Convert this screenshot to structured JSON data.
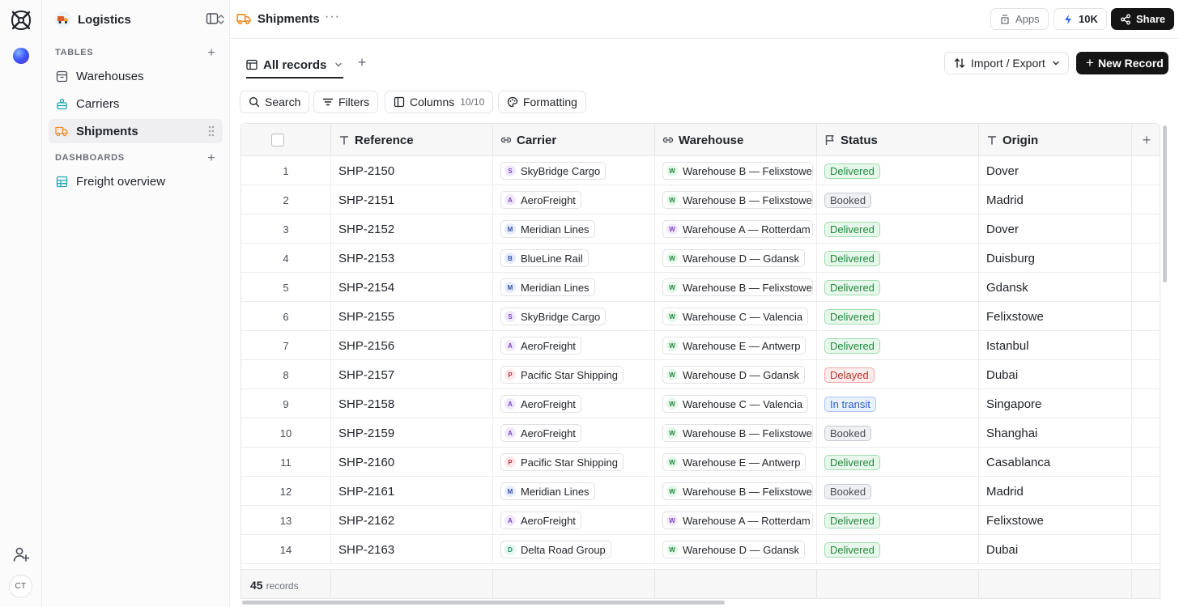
{
  "rail": {
    "avatar_initials": "CT"
  },
  "sidebar": {
    "workspace": "Logistics",
    "tables_heading": "TABLES",
    "tables": [
      {
        "label": "Warehouses",
        "icon": "warehouse-icon",
        "color": "#4a4e55",
        "active": false
      },
      {
        "label": "Carriers",
        "icon": "carriers-icon",
        "color": "#1ba7b0",
        "active": false
      },
      {
        "label": "Shipments",
        "icon": "truck-icon",
        "color": "#f08a24",
        "active": true
      }
    ],
    "dashboards_heading": "DASHBOARDS",
    "dashboards": [
      {
        "label": "Freight overview",
        "icon": "dashboard-icon",
        "color": "#1ba7b0"
      }
    ]
  },
  "topbar": {
    "title": "Shipments",
    "apps_label": "Apps",
    "credits_label": "10K",
    "share_label": "Share"
  },
  "view": {
    "tab_label": "All records",
    "import_label": "Import / Export",
    "new_record_label": "New Record"
  },
  "toolbar": {
    "search_label": "Search",
    "filters_label": "Filters",
    "columns_label": "Columns",
    "columns_count": "10/10",
    "formatting_label": "Formatting"
  },
  "table": {
    "columns": [
      {
        "label": "Reference",
        "icon": "text-type-icon"
      },
      {
        "label": "Carrier",
        "icon": "link-icon"
      },
      {
        "label": "Warehouse",
        "icon": "link-icon"
      },
      {
        "label": "Status",
        "icon": "flag-icon"
      },
      {
        "label": "Origin",
        "icon": "text-type-icon"
      }
    ],
    "rows": [
      {
        "num": "1",
        "ref": "SHP-2150",
        "carrier": "SkyBridge Cargo",
        "carrier_initial": "S",
        "warehouse": "Warehouse B — Felixstowe",
        "wh_initial": "W",
        "status": "Delivered",
        "origin": "Dover"
      },
      {
        "num": "2",
        "ref": "SHP-2151",
        "carrier": "AeroFreight",
        "carrier_initial": "A",
        "warehouse": "Warehouse B — Felixstowe",
        "wh_initial": "W",
        "status": "Booked",
        "origin": "Madrid"
      },
      {
        "num": "3",
        "ref": "SHP-2152",
        "carrier": "Meridian Lines",
        "carrier_initial": "M",
        "warehouse": "Warehouse A — Rotterdam",
        "wh_initial": "W",
        "status": "Delivered",
        "origin": "Dover"
      },
      {
        "num": "4",
        "ref": "SHP-2153",
        "carrier": "BlueLine Rail",
        "carrier_initial": "B",
        "warehouse": "Warehouse D — Gdansk",
        "wh_initial": "W",
        "status": "Delivered",
        "origin": "Duisburg"
      },
      {
        "num": "5",
        "ref": "SHP-2154",
        "carrier": "Meridian Lines",
        "carrier_initial": "M",
        "warehouse": "Warehouse B — Felixstowe",
        "wh_initial": "W",
        "status": "Delivered",
        "origin": "Gdansk"
      },
      {
        "num": "6",
        "ref": "SHP-2155",
        "carrier": "SkyBridge Cargo",
        "carrier_initial": "S",
        "warehouse": "Warehouse C — Valencia",
        "wh_initial": "W",
        "status": "Delivered",
        "origin": "Felixstowe"
      },
      {
        "num": "7",
        "ref": "SHP-2156",
        "carrier": "AeroFreight",
        "carrier_initial": "A",
        "warehouse": "Warehouse E — Antwerp",
        "wh_initial": "W",
        "status": "Delivered",
        "origin": "Istanbul"
      },
      {
        "num": "8",
        "ref": "SHP-2157",
        "carrier": "Pacific Star Shipping",
        "carrier_initial": "P",
        "warehouse": "Warehouse D — Gdansk",
        "wh_initial": "W",
        "status": "Delayed",
        "origin": "Dubai"
      },
      {
        "num": "9",
        "ref": "SHP-2158",
        "carrier": "AeroFreight",
        "carrier_initial": "A",
        "warehouse": "Warehouse C — Valencia",
        "wh_initial": "W",
        "status": "In transit",
        "origin": "Singapore"
      },
      {
        "num": "10",
        "ref": "SHP-2159",
        "carrier": "AeroFreight",
        "carrier_initial": "A",
        "warehouse": "Warehouse B — Felixstowe",
        "wh_initial": "W",
        "status": "Booked",
        "origin": "Shanghai"
      },
      {
        "num": "11",
        "ref": "SHP-2160",
        "carrier": "Pacific Star Shipping",
        "carrier_initial": "P",
        "warehouse": "Warehouse E — Antwerp",
        "wh_initial": "W",
        "status": "Delivered",
        "origin": "Casablanca"
      },
      {
        "num": "12",
        "ref": "SHP-2161",
        "carrier": "Meridian Lines",
        "carrier_initial": "M",
        "warehouse": "Warehouse B — Felixstowe",
        "wh_initial": "W",
        "status": "Booked",
        "origin": "Madrid"
      },
      {
        "num": "13",
        "ref": "SHP-2162",
        "carrier": "AeroFreight",
        "carrier_initial": "A",
        "warehouse": "Warehouse A — Rotterdam",
        "wh_initial": "W",
        "status": "Delivered",
        "origin": "Felixstowe"
      },
      {
        "num": "14",
        "ref": "SHP-2163",
        "carrier": "Delta Road Group",
        "carrier_initial": "D",
        "warehouse": "Warehouse D — Gdansk",
        "wh_initial": "W",
        "status": "Delivered",
        "origin": "Dubai"
      }
    ],
    "record_count": "45",
    "record_label": "records"
  },
  "colors": {
    "status": {
      "Delivered": {
        "bg": "#e8f7ec",
        "fg": "#1f8a3b",
        "border": "#9fdcae"
      },
      "Booked": {
        "bg": "#eef0f3",
        "fg": "#4a4e55",
        "border": "#c6cad1"
      },
      "Delayed": {
        "bg": "#fdecec",
        "fg": "#c0322b",
        "border": "#f2a9a5"
      },
      "In transit": {
        "bg": "#e9f1fd",
        "fg": "#2d62c9",
        "border": "#a9c5f1"
      }
    },
    "initials": {
      "S": {
        "bg": "#f1e9fb",
        "fg": "#7b3fc6"
      },
      "A": {
        "bg": "#f1e9fb",
        "fg": "#7b3fc6"
      },
      "M": {
        "bg": "#e6ecfb",
        "fg": "#2f4fb5"
      },
      "B": {
        "bg": "#e6ecfb",
        "fg": "#2f4fb5"
      },
      "P": {
        "bg": "#fce8ea",
        "fg": "#c42f3e"
      },
      "D": {
        "bg": "#e3f6f0",
        "fg": "#1a8e6a"
      },
      "W_green": {
        "bg": "#e5f6ea",
        "fg": "#1f8a3b"
      },
      "W_purple": {
        "bg": "#f1e9fb",
        "fg": "#7b3fc6"
      }
    }
  }
}
